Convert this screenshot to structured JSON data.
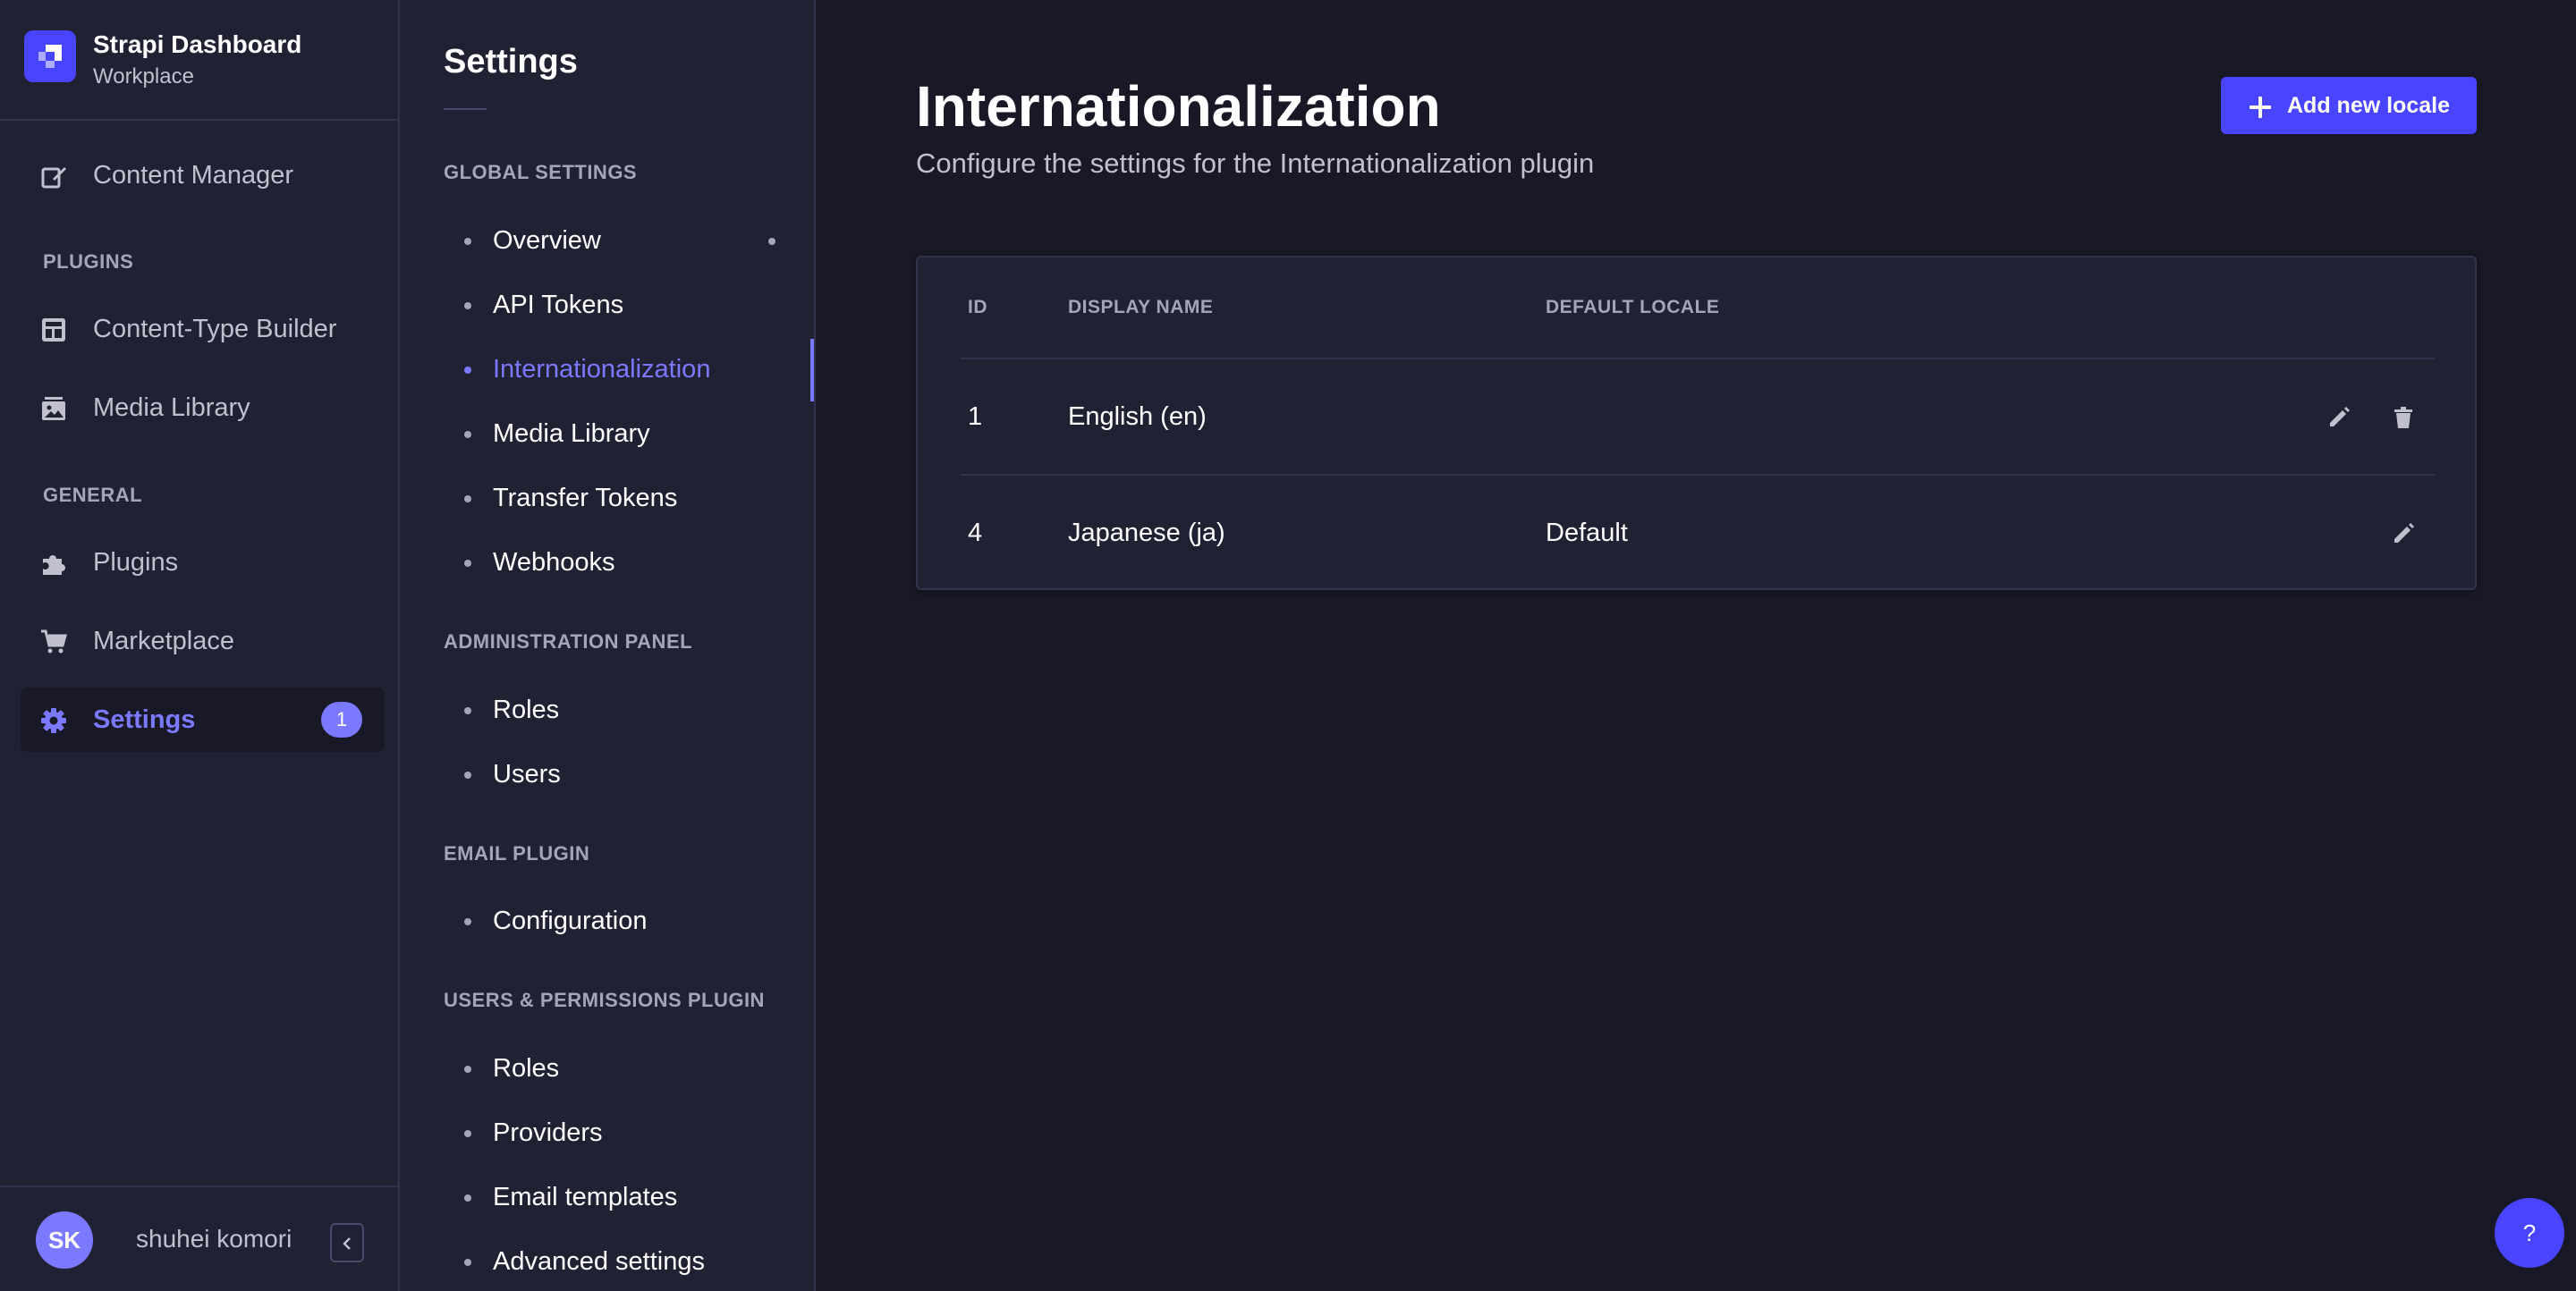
{
  "brand": {
    "title": "Strapi Dashboard",
    "subtitle": "Workplace"
  },
  "mainnav": {
    "items": [
      {
        "label": "Content Manager",
        "icon": "feather-icon"
      }
    ],
    "sections": [
      {
        "title": "PLUGINS",
        "items": [
          {
            "label": "Content-Type Builder",
            "icon": "layout-icon"
          },
          {
            "label": "Media Library",
            "icon": "images-icon"
          }
        ]
      },
      {
        "title": "GENERAL",
        "items": [
          {
            "label": "Plugins",
            "icon": "puzzle-icon"
          },
          {
            "label": "Marketplace",
            "icon": "cart-icon"
          },
          {
            "label": "Settings",
            "icon": "gear-icon",
            "active": true,
            "badge": "1"
          }
        ]
      }
    ],
    "user": {
      "initials": "SK",
      "name": "shuhei komori"
    }
  },
  "subnav": {
    "title": "Settings",
    "sections": [
      {
        "title": "GLOBAL SETTINGS",
        "items": [
          "Overview",
          "API Tokens",
          "Internationalization",
          "Media Library",
          "Transfer Tokens",
          "Webhooks"
        ]
      },
      {
        "title": "ADMINISTRATION PANEL",
        "items": [
          "Roles",
          "Users"
        ]
      },
      {
        "title": "EMAIL PLUGIN",
        "items": [
          "Configuration"
        ]
      },
      {
        "title": "USERS & PERMISSIONS PLUGIN",
        "items": [
          "Roles",
          "Providers",
          "Email templates",
          "Advanced settings"
        ]
      }
    ],
    "active_item": "Internationalization"
  },
  "content": {
    "title": "Internationalization",
    "subtitle": "Configure the settings for the Internationalization plugin",
    "add_button": "Add new locale",
    "table": {
      "headers": [
        "ID",
        "DISPLAY NAME",
        "DEFAULT LOCALE"
      ],
      "rows": [
        {
          "id": "1",
          "name": "English (en)",
          "default": "",
          "actions": [
            "edit",
            "delete"
          ]
        },
        {
          "id": "4",
          "name": "Japanese (ja)",
          "default": "Default",
          "actions": [
            "edit"
          ]
        }
      ]
    }
  },
  "help": {
    "label": "?"
  },
  "colors": {
    "primary": "#4945ff",
    "accent": "#7b79ff",
    "surface": "#212134",
    "background": "#181826",
    "border": "#32324d"
  }
}
